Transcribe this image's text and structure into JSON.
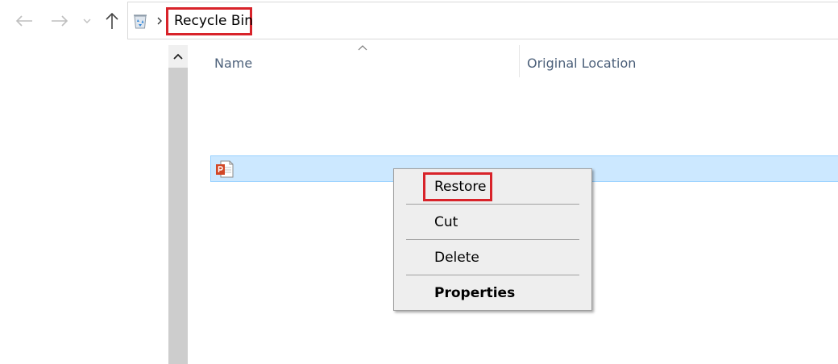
{
  "toolbar": {
    "back_icon": "back-arrow-icon",
    "forward_icon": "forward-arrow-icon",
    "recent_icon": "chevron-down-icon",
    "up_icon": "up-arrow-icon"
  },
  "address": {
    "location_icon": "recycle-bin-icon",
    "separator_icon": "chevron-right-icon",
    "crumb": "Recycle Bin"
  },
  "columns": {
    "name": "Name",
    "original_location": "Original Location",
    "sort_icon": "sort-ascending-icon"
  },
  "file": {
    "icon": "powerpoint-file-icon",
    "name": "",
    "selected": true
  },
  "context_menu": {
    "items": [
      {
        "label": "Restore",
        "bold": false
      },
      {
        "label": "Cut",
        "bold": false
      },
      {
        "label": "Delete",
        "bold": false
      },
      {
        "label": "Properties",
        "bold": true
      }
    ]
  },
  "colors": {
    "highlight": "#d8232a",
    "selection": "#cce8ff",
    "header_text": "#4c607a",
    "menu_bg": "#eeeeee"
  }
}
